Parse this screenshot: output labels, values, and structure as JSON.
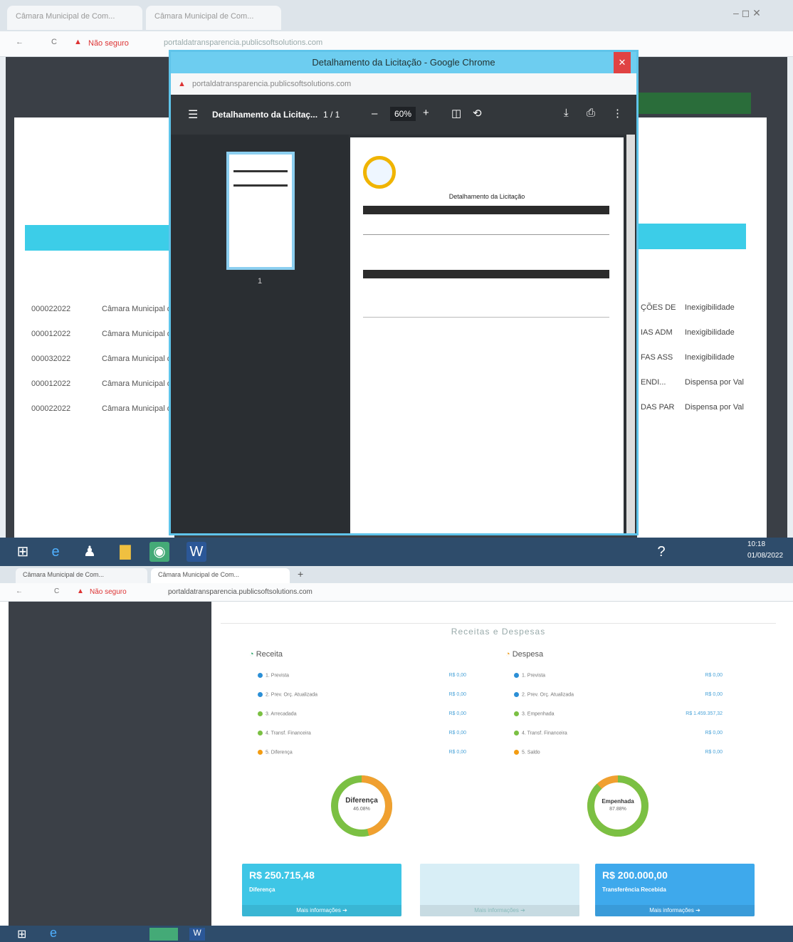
{
  "top": {
    "tabs": [
      "Câmara Municipal de Com...",
      "Câmara Municipal de Com..."
    ],
    "address": "portaldatransparencia.publicsoftsolutions.com",
    "not_secure": "Não seguro",
    "left_rows": [
      {
        "num": "000022022",
        "entity": "Câmara Municipal de"
      },
      {
        "num": "000012022",
        "entity": "Câmara Municipal de"
      },
      {
        "num": "000032022",
        "entity": "Câmara Municipal de"
      },
      {
        "num": "000012022",
        "entity": "Câmara Municipal de"
      },
      {
        "num": "000022022",
        "entity": "Câmara Municipal de"
      }
    ],
    "right_rows": [
      {
        "obj": "ÇÕES DE",
        "mod": "Inexigibilidade"
      },
      {
        "obj": "IAS ADM",
        "mod": "Inexigibilidade"
      },
      {
        "obj": "FAS ASS",
        "mod": "Inexigibilidade"
      },
      {
        "obj": "ENDI...",
        "mod": "Dispensa por Val"
      },
      {
        "obj": "DAS PAR",
        "mod": "Dispensa por Val"
      }
    ],
    "popup": {
      "window_title": "Detalhamento da Licitação - Google Chrome",
      "address": "portaldatransparencia.publicsoftsolutions.com",
      "pdf_title": "Detalhamento da Licitaç...",
      "page_counter": "1 / 1",
      "zoom": "60%",
      "doc_heading": "Detalhamento da Licitação",
      "thumb_page": "1"
    },
    "taskbar": {
      "time": "10:18",
      "date": "01/08/2022"
    }
  },
  "bottom": {
    "tabs": [
      "Câmara Municipal de Com...",
      "Câmara Municipal de Com..."
    ],
    "address": "portaldatransparencia.publicsoftsolutions.com",
    "not_secure": "Não seguro",
    "section_title": "Receitas e Despesas",
    "receita": {
      "heading": "Receita",
      "items": [
        {
          "label": "1. Prevista",
          "value": "R$ 0,00",
          "color": "#2b8fd6"
        },
        {
          "label": "2. Prev. Orç. Atualizada",
          "value": "R$ 0,00",
          "color": "#2b8fd6"
        },
        {
          "label": "3. Arrecadada",
          "value": "R$ 0,00",
          "color": "#7bc043"
        },
        {
          "label": "4. Transf. Financeira",
          "value": "R$ 0,00",
          "color": "#7bc043"
        },
        {
          "label": "5. Diferença",
          "value": "R$ 0,00",
          "color": "#f39c12"
        }
      ],
      "donut_label": "Diferença",
      "donut_pct": "46.08%",
      "donut_value": 46.08
    },
    "despesa": {
      "heading": "Despesa",
      "items": [
        {
          "label": "1. Prevista",
          "value": "R$ 0,00",
          "color": "#2b8fd6"
        },
        {
          "label": "2. Prev. Orç. Atualizada",
          "value": "R$ 0,00",
          "color": "#2b8fd6"
        },
        {
          "label": "3. Empenhada",
          "value": "R$ 1.459.357,32",
          "color": "#7bc043"
        },
        {
          "label": "4. Transf. Financeira",
          "value": "R$ 0,00",
          "color": "#7bc043"
        },
        {
          "label": "5. Saldo",
          "value": "R$ 0,00",
          "color": "#f39c12"
        }
      ],
      "donut_label": "Empenhada",
      "donut_pct": "87.88%",
      "donut_value": 87.88
    },
    "boxes": [
      {
        "amount": "R$ 250.715,48",
        "desc": "Diferença",
        "foot": "Mais informações"
      },
      {
        "amount": "",
        "desc": "",
        "foot": "Mais informações"
      },
      {
        "amount": "R$ 200.000,00",
        "desc": "Transferência Recebida",
        "foot": "Mais informações"
      }
    ]
  }
}
